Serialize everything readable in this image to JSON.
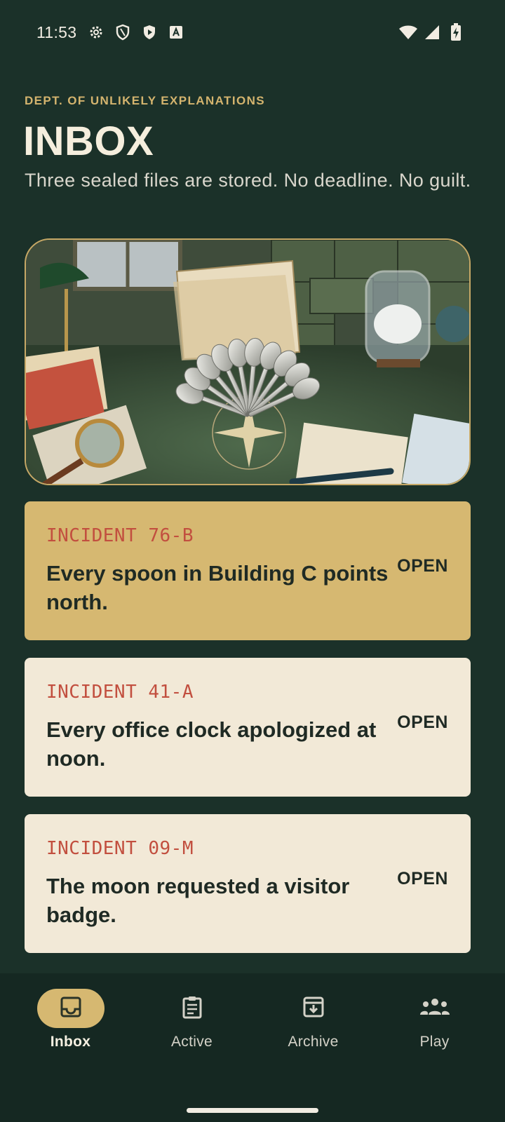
{
  "status_bar": {
    "time": "11:53",
    "icons": [
      "gear-icon",
      "shield-icon",
      "play-shield-icon",
      "font-a-icon"
    ],
    "right_icons": [
      "wifi-icon",
      "cell-signal-icon",
      "battery-charging-icon"
    ]
  },
  "header": {
    "kicker": "DEPT. OF UNLIKELY EXPLANATIONS",
    "title": "INBOX",
    "subtitle": "Three sealed files are stored. No deadline. No guilt."
  },
  "incidents": [
    {
      "code": "INCIDENT 76-B",
      "text": "Every spoon in Building C points north.",
      "status": "OPEN",
      "highlighted": true
    },
    {
      "code": "INCIDENT 41-A",
      "text": "Every office clock apologized at noon.",
      "status": "OPEN",
      "highlighted": false
    },
    {
      "code": "INCIDENT 09-M",
      "text": "The moon requested a visitor badge.",
      "status": "OPEN",
      "highlighted": false
    }
  ],
  "nav": [
    {
      "label": "Inbox",
      "icon": "inbox-icon",
      "active": true
    },
    {
      "label": "Active",
      "icon": "clipboard-icon",
      "active": false
    },
    {
      "label": "Archive",
      "icon": "archive-icon",
      "active": false
    },
    {
      "label": "Play",
      "icon": "group-icon",
      "active": false
    }
  ],
  "colors": {
    "background": "#1b3129",
    "accent_gold": "#d6b871",
    "card_cream": "#f2e9d7",
    "code_red": "#c24f3f"
  }
}
